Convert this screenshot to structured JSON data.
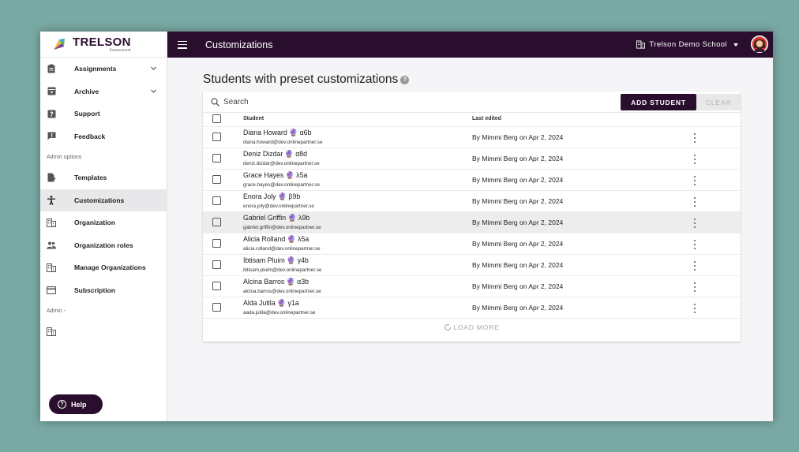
{
  "brand": {
    "name": "TRELSON",
    "sub": "Assessment"
  },
  "topbar": {
    "title": "Customizations",
    "school": "Trelson Demo School"
  },
  "sidebar": {
    "items": [
      {
        "label": "Assignments",
        "icon": "clipboard-icon",
        "expandable": true
      },
      {
        "label": "Archive",
        "icon": "archive-icon",
        "expandable": true
      },
      {
        "label": "Support",
        "icon": "help-square-icon"
      },
      {
        "label": "Feedback",
        "icon": "feedback-icon"
      }
    ],
    "admin_options_label": "Admin options",
    "admin_items": [
      {
        "label": "Templates",
        "icon": "template-icon"
      },
      {
        "label": "Customizations",
        "icon": "accessibility-icon",
        "active": true
      },
      {
        "label": "Organization",
        "icon": "building-icon"
      },
      {
        "label": "Organization roles",
        "icon": "people-icon"
      },
      {
        "label": "Manage Organizations",
        "icon": "building-icon"
      },
      {
        "label": "Subscription",
        "icon": "card-icon"
      }
    ],
    "admin_label": "Admin -",
    "help_label": "Help"
  },
  "main": {
    "title": "Students with preset customizations",
    "search_placeholder": "Search",
    "add_student_label": "ADD STUDENT",
    "clear_label": "CLEAR",
    "columns": {
      "student": "Student",
      "last_edited": "Last edited"
    },
    "rows": [
      {
        "name": "Diana Howard 🔮 α6b",
        "email": "diana.howard@dev.onlinepartner.se",
        "edited": "By Mimmi Berg on Apr 2, 2024"
      },
      {
        "name": "Deniz Dizdar 🔮 α8d",
        "email": "deniz.dizdar@dev.onlinepartner.se",
        "edited": "By Mimmi Berg on Apr 2, 2024"
      },
      {
        "name": "Grace Hayes 🔮 λ5a",
        "email": "grace.hayes@dev.onlinepartner.se",
        "edited": "By Mimmi Berg on Apr 2, 2024"
      },
      {
        "name": "Enora Joly 🔮 β9b",
        "email": "enora.joly@dev.onlinepartner.se",
        "edited": "By Mimmi Berg on Apr 2, 2024"
      },
      {
        "name": "Gabriel Griffin 🔮 λ9b",
        "email": "gabriel.griffin@dev.onlinepartner.se",
        "edited": "By Mimmi Berg on Apr 2, 2024"
      },
      {
        "name": "Alicia Rolland 🔮 λ5a",
        "email": "alicia.rolland@dev.onlinepartner.se",
        "edited": "By Mimmi Berg on Apr 2, 2024"
      },
      {
        "name": "Ibtisam Pluim 🔮 γ4b",
        "email": "ibtisam.pluim@dev.onlinepartner.se",
        "edited": "By Mimmi Berg on Apr 2, 2024"
      },
      {
        "name": "Alcina Barros 🔮 α3b",
        "email": "alcina.barros@dev.onlinepartner.se",
        "edited": "By Mimmi Berg on Apr 2, 2024"
      },
      {
        "name": "Alda Jutila 🔮 γ1a",
        "email": "aada.jutila@dev.onlinepartner.se",
        "edited": "By Mimmi Berg on Apr 2, 2024"
      }
    ],
    "load_more_label": "LOAD MORE"
  },
  "colors": {
    "brand_dark": "#2a0e2e",
    "background": "#7aa9a4"
  }
}
